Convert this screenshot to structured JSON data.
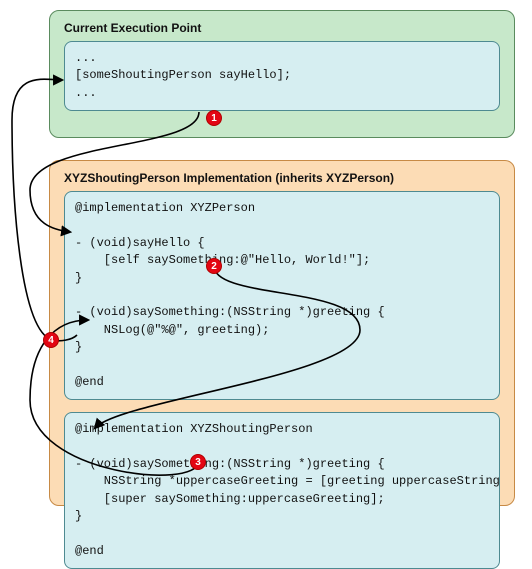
{
  "panels": {
    "exec": {
      "title": "Current Execution Point",
      "code": {
        "l1": "...",
        "l2": "[someShoutingPerson sayHello];",
        "l3": "..."
      }
    },
    "impl": {
      "title": "XYZShoutingPerson Implementation (inherits XYZPerson)",
      "code1": {
        "l1": "@implementation XYZPerson",
        "l2": "",
        "l3": "- (void)sayHello {",
        "l4": "    [self saySomething:@\"Hello, World!\"];",
        "l5": "}",
        "l6": "",
        "l7": "- (void)saySomething:(NSString *)greeting {",
        "l8": "    NSLog(@\"%@\", greeting);",
        "l9": "}",
        "l10": "",
        "l11": "@end"
      },
      "code2": {
        "l1": "@implementation XYZShoutingPerson",
        "l2": "",
        "l3": "- (void)saySomething:(NSString *)greeting {",
        "l4": "    NSString *uppercaseGreeting = [greeting uppercaseString];",
        "l5": "    [super saySomething:uppercaseGreeting];",
        "l6": "}",
        "l7": "",
        "l8": "@end"
      }
    }
  },
  "badges": {
    "b1": "1",
    "b2": "2",
    "b3": "3",
    "b4": "4"
  }
}
